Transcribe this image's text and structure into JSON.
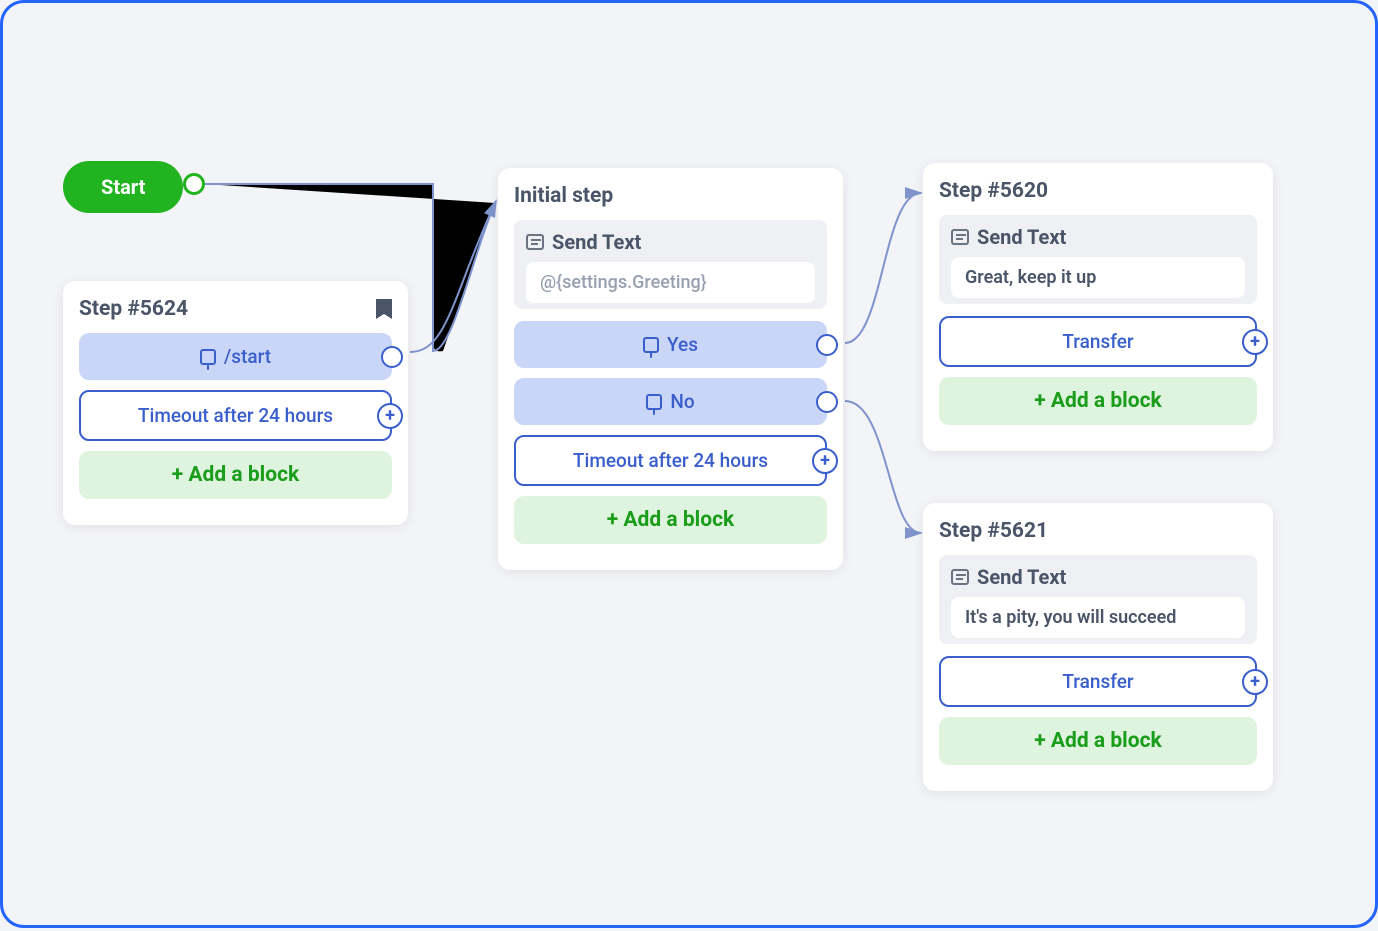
{
  "start": {
    "label": "Start"
  },
  "nodes": {
    "n5624": {
      "title": "Step #5624",
      "start_cmd": "/start",
      "timeout": "Timeout after 24 hours",
      "add_block": "+ Add a block"
    },
    "initial": {
      "title": "Initial step",
      "sendtext_label": "Send Text",
      "sendtext_body": "@{settings.Greeting}",
      "yes": "Yes",
      "no": "No",
      "timeout": "Timeout after 24 hours",
      "add_block": "+ Add a block"
    },
    "n5620": {
      "title": "Step #5620",
      "sendtext_label": "Send Text",
      "sendtext_body": "Great, keep it up",
      "transfer": "Transfer",
      "add_block": "+ Add a block"
    },
    "n5621": {
      "title": "Step #5621",
      "sendtext_label": "Send Text",
      "sendtext_body": "It's a pity, you will succeed",
      "transfer": "Transfer",
      "add_block": "+ Add a block"
    }
  }
}
